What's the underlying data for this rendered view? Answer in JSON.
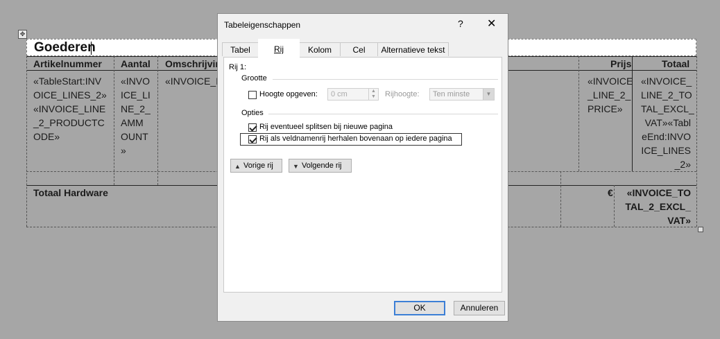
{
  "document": {
    "heading": "Goederen",
    "table": {
      "headers": [
        "Artikelnummer",
        "Aantal",
        "Omschrijvin",
        "Prijs",
        "Totaal"
      ],
      "row1": {
        "artikelnummer": "«TableStart:INV\nOICE_LINES_2»\n«INVOICE_LINE\n_2_PRODUCTC\nODE»",
        "aantal": "«INVO\nICE_LI\nNE_2_\nAMM\nOUNT\n»",
        "omschrijving": "«INVOICE_I",
        "prijs": "«INVOICE\n_LINE_2_\nPRICE»",
        "totaal": "«INVOICE_\nLINE_2_TO\nTAL_EXCL_\nVAT»«Tabl\neEnd:INVO\nICE_LINES\n_2»"
      },
      "footer": {
        "label": "Totaal Hardware",
        "currency": "€",
        "total": "«INVOICE_TO\nTAL_2_EXCL_\nVAT»"
      }
    }
  },
  "dialog": {
    "title": "Tabeleigenschappen",
    "help": "?",
    "close": "✕",
    "tabs": [
      "Tabel",
      "Rij",
      "Kolom",
      "Cel",
      "Alternatieve tekst"
    ],
    "active_tab": "Rij",
    "row_label": "Rij 1:",
    "size_group": "Grootte",
    "height_label": "Hoogte opgeven:",
    "height_checked": false,
    "height_value": "0 cm",
    "row_height_label": "Rijhoogte:",
    "row_height_value": "Ten minste",
    "options_group": "Opties",
    "split_label": "Rij eventueel splitsen bij nieuwe pagina",
    "split_checked": true,
    "repeat_label": "Rij als veldnamenrij herhalen bovenaan op iedere pagina",
    "repeat_checked": true,
    "prev_row": "Vorige rij",
    "next_row": "Volgende rij",
    "ok": "OK",
    "cancel": "Annuleren"
  }
}
